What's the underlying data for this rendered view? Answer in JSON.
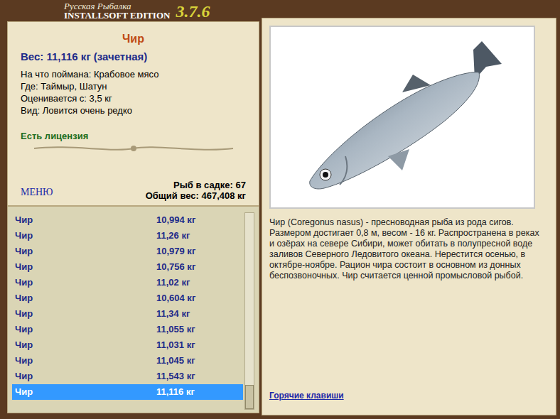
{
  "header": {
    "game_title": "Русская Рыбалка",
    "edition": "INSTALLSOFT EDITION",
    "version": "3.7.6"
  },
  "fish_card": {
    "name": "Чир",
    "weight": "Вес: 11,116 кг (зачетная)",
    "details": [
      "На что поймана: Крабовое мясо",
      "Где: Таймыр, Шатун",
      "Оценивается с: 3,5 кг",
      "Вид: Ловится очень редко"
    ],
    "license": "Есть лицензия"
  },
  "menu_link": "МЕНЮ",
  "keepnet": {
    "count": "Рыб в садке: 67",
    "total": "Общий вес: 467,408 кг"
  },
  "catch_list": {
    "scroll_level": 1,
    "rows": [
      {
        "name": "Чир",
        "weight": "10,994 кг",
        "selected": false
      },
      {
        "name": "Чир",
        "weight": "11,26 кг",
        "selected": false
      },
      {
        "name": "Чир",
        "weight": "10,979 кг",
        "selected": false
      },
      {
        "name": "Чир",
        "weight": "10,756 кг",
        "selected": false
      },
      {
        "name": "Чир",
        "weight": "11,02 кг",
        "selected": false
      },
      {
        "name": "Чир",
        "weight": "10,604 кг",
        "selected": false
      },
      {
        "name": "Чир",
        "weight": "11,34 кг",
        "selected": false
      },
      {
        "name": "Чир",
        "weight": "11,055 кг",
        "selected": false
      },
      {
        "name": "Чир",
        "weight": "11,031 кг",
        "selected": false
      },
      {
        "name": "Чир",
        "weight": "11,045 кг",
        "selected": false
      },
      {
        "name": "Чир",
        "weight": "11,543 кг",
        "selected": false
      },
      {
        "name": "Чир",
        "weight": "11,116 кг",
        "selected": true
      }
    ]
  },
  "description": "Чир (Coregonus nasus) - пресноводная рыба из рода сигов. Размером достигает 0,8 м, весом - 16 кг. Распространена в реках и озёрах на севере Сибири, может обитать в полупресной воде заливов Северного Ледовитого океана. Нерестится осенью, в октябре-ноябре. Рацион чира состоит в основном из донных беспозвоночных. Чир считается ценной промысловой рыбой.",
  "hotkeys_link": "Горячие клавиши"
}
